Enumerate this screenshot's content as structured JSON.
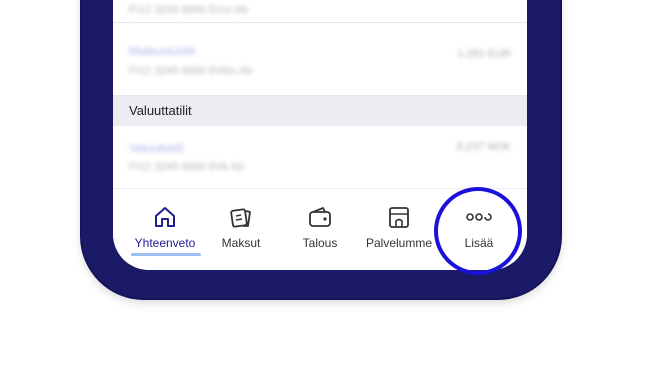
{
  "accounts": [
    {
      "name": "",
      "iban": "FI12 3245 6890 Erno Ab",
      "amount": ""
    },
    {
      "name": "Matkustustili",
      "iban": "FI12 3245 6890 Erikin Ab",
      "amount": "1.281 EUR"
    }
  ],
  "section_currency": "Valuuttatilit",
  "currency_accounts": [
    {
      "name": "Valuuttatili",
      "iban": "FI12 3245 6890 Erik Ab",
      "amount": "8.237 NOK"
    }
  ],
  "tabs": [
    {
      "label": "Yhteenveto",
      "icon": "home-icon"
    },
    {
      "label": "Maksut",
      "icon": "payments-icon"
    },
    {
      "label": "Talous",
      "icon": "wallet-icon"
    },
    {
      "label": "Palvelumme",
      "icon": "store-icon"
    },
    {
      "label": "Lisää",
      "icon": "more-icon"
    }
  ],
  "colors": {
    "frame": "#1b1a66",
    "active_tab": "#1e2090",
    "highlight_ring": "#1a12d8",
    "underline": "#9ec0f0"
  }
}
